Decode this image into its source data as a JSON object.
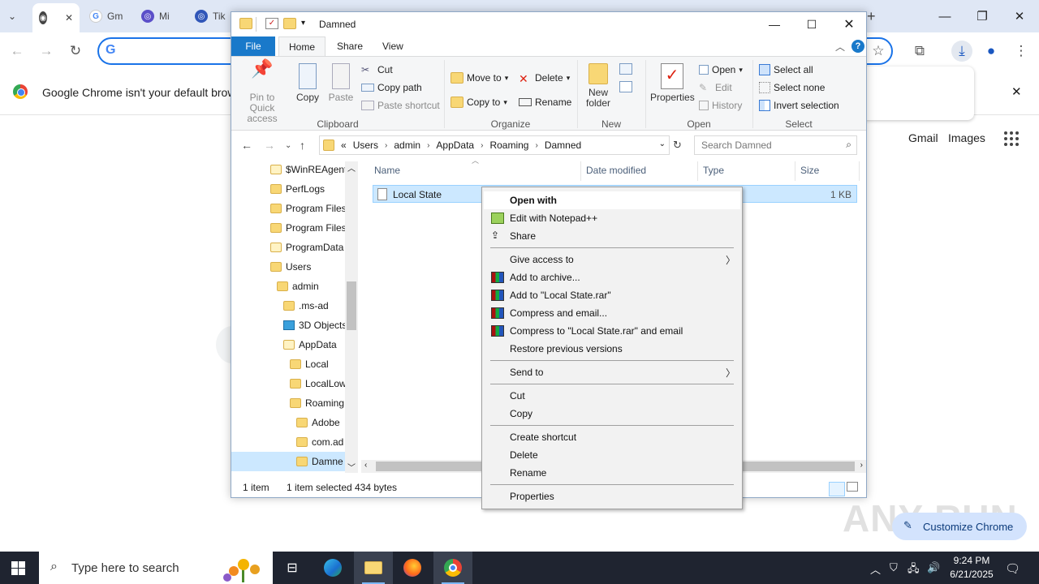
{
  "chrome": {
    "tabs": [
      {
        "label": "",
        "icon": "chrome-icon"
      },
      {
        "label": "Gm",
        "icon": "google-icon"
      },
      {
        "label": "Mi",
        "icon": "site-icon"
      },
      {
        "label": "Tik",
        "icon": "site-icon"
      }
    ],
    "infobar_text": "Google Chrome isn't your default browse",
    "links": {
      "gmail": "Gmail",
      "images": "Images"
    },
    "customize_label": "Customize Chrome",
    "watermark": "ANY RUN"
  },
  "explorer": {
    "title": "Damned",
    "ribbon_tabs": {
      "file": "File",
      "home": "Home",
      "share": "Share",
      "view": "View"
    },
    "clipboard": {
      "pin": "Pin to Quick access",
      "copy": "Copy",
      "paste": "Paste",
      "cut": "Cut",
      "copy_path": "Copy path",
      "paste_shortcut": "Paste shortcut",
      "group": "Clipboard"
    },
    "organize": {
      "move_to": "Move to",
      "copy_to": "Copy to",
      "delete": "Delete",
      "rename": "Rename",
      "group": "Organize"
    },
    "new": {
      "new_folder": "New folder",
      "group": "New"
    },
    "open": {
      "properties": "Properties",
      "open": "Open",
      "edit": "Edit",
      "history": "History",
      "group": "Open"
    },
    "select": {
      "select_all": "Select all",
      "select_none": "Select none",
      "invert": "Invert selection",
      "group": "Select"
    },
    "address": {
      "prefix": "«",
      "crumbs": [
        "Users",
        "admin",
        "AppData",
        "Roaming",
        "Damned"
      ]
    },
    "search_placeholder": "Search Damned",
    "nav_items": [
      {
        "label": "$WinREAgent"
      },
      {
        "label": "PerfLogs"
      },
      {
        "label": "Program Files"
      },
      {
        "label": "Program Files"
      },
      {
        "label": "ProgramData"
      },
      {
        "label": "Users"
      },
      {
        "label": "admin"
      },
      {
        "label": ".ms-ad"
      },
      {
        "label": "3D Objects"
      },
      {
        "label": "AppData"
      },
      {
        "label": "Local"
      },
      {
        "label": "LocalLow"
      },
      {
        "label": "Roaming"
      },
      {
        "label": "Adobe"
      },
      {
        "label": "com.ad"
      },
      {
        "label": "Damne"
      }
    ],
    "columns": {
      "name": "Name",
      "date": "Date modified",
      "type": "Type",
      "size": "Size"
    },
    "file": {
      "name": "Local State",
      "size": "1 KB"
    },
    "status": {
      "count": "1 item",
      "selected": "1 item selected",
      "bytes": "434 bytes"
    }
  },
  "context_menu": {
    "open_with": "Open with",
    "edit_notepad": "Edit with Notepad++",
    "share": "Share",
    "give_access": "Give access to",
    "add_archive": "Add to archive...",
    "add_rar": "Add to \"Local State.rar\"",
    "compress_email": "Compress and email...",
    "compress_rar_email": "Compress to \"Local State.rar\" and email",
    "restore": "Restore previous versions",
    "send_to": "Send to",
    "cut": "Cut",
    "copy": "Copy",
    "create_shortcut": "Create shortcut",
    "delete": "Delete",
    "rename": "Rename",
    "properties": "Properties"
  },
  "taskbar": {
    "search_placeholder": "Type here to search",
    "time": "9:24 PM",
    "date": "6/21/2025"
  },
  "colors": {
    "accent": "#1979ca",
    "selection": "#cce8ff",
    "taskbar": "#1f2430"
  }
}
